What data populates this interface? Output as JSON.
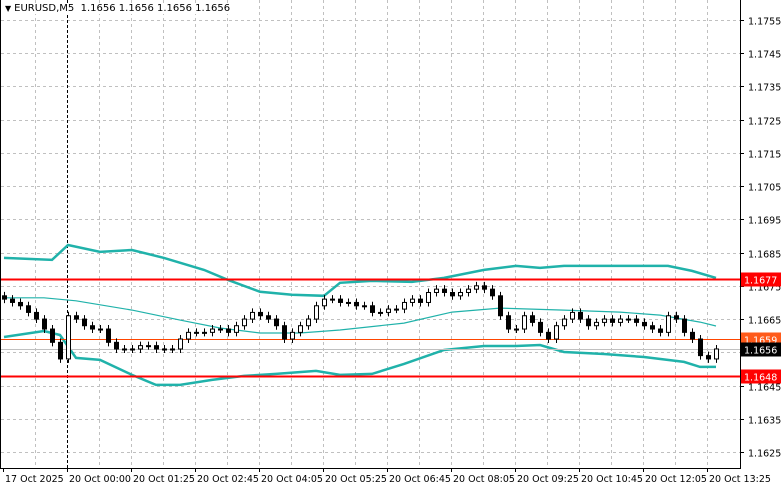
{
  "header": {
    "symbol": "EURUSD,M5",
    "ohlc": "1.1656 1.1656 1.1656 1.1656",
    "menu_icon": "triangle-down-icon"
  },
  "colors": {
    "bull_body": "#ffffff",
    "bear_body": "#000000",
    "bands": "#20b2aa",
    "resistance": "#ff0000",
    "pivot": "#ff4500",
    "bid_line": "#c0c0c0",
    "grid": "#c0c0c0"
  },
  "chart_data": {
    "type": "candlestick",
    "title": "EURUSD,M5",
    "ylim": [
      1.162,
      1.176
    ],
    "y_ticks": [
      "1.1755",
      "1.1745",
      "1.1735",
      "1.1725",
      "1.1715",
      "1.1705",
      "1.1695",
      "1.1685",
      "1.1675",
      "1.1665",
      "1.1655",
      "1.1645",
      "1.1635",
      "1.1625"
    ],
    "x_ticks": [
      {
        "bar": 0,
        "label": "17 Oct 2025"
      },
      {
        "bar": 8,
        "label": "20 Oct 00:00"
      },
      {
        "bar": 16,
        "label": "20 Oct 01:25"
      },
      {
        "bar": 24,
        "label": "20 Oct 02:45"
      },
      {
        "bar": 32,
        "label": "20 Oct 04:05"
      },
      {
        "bar": 40,
        "label": "20 Oct 05:25"
      },
      {
        "bar": 48,
        "label": "20 Oct 06:45"
      },
      {
        "bar": 56,
        "label": "20 Oct 08:05"
      },
      {
        "bar": 64,
        "label": "20 Oct 09:25"
      },
      {
        "bar": 72,
        "label": "20 Oct 10:45"
      },
      {
        "bar": 80,
        "label": "20 Oct 12:05"
      },
      {
        "bar": 88,
        "label": "20 Oct 13:25"
      }
    ],
    "period_separator_bar": 8,
    "closes": [
      1.1671,
      1.167,
      1.1669,
      1.1667,
      1.1665,
      1.1662,
      1.1658,
      1.1653,
      1.1666,
      1.1665,
      1.1663,
      1.1662,
      1.1662,
      1.1658,
      1.1656,
      1.1656,
      1.1656,
      1.1657,
      1.1657,
      1.1656,
      1.1656,
      1.1656,
      1.1659,
      1.1661,
      1.1661,
      1.1661,
      1.1662,
      1.1662,
      1.1661,
      1.1663,
      1.1665,
      1.1667,
      1.1666,
      1.1665,
      1.1663,
      1.1659,
      1.1661,
      1.1663,
      1.1665,
      1.1669,
      1.1671,
      1.1671,
      1.167,
      1.167,
      1.1669,
      1.1669,
      1.1667,
      1.1667,
      1.1668,
      1.1668,
      1.167,
      1.1671,
      1.167,
      1.1673,
      1.1674,
      1.1673,
      1.1672,
      1.1673,
      1.1674,
      1.1675,
      1.1674,
      1.1672,
      1.1666,
      1.1662,
      1.1662,
      1.1666,
      1.1664,
      1.1661,
      1.1659,
      1.1663,
      1.1665,
      1.1667,
      1.1665,
      1.1663,
      1.1664,
      1.1665,
      1.1664,
      1.1665,
      1.1665,
      1.1664,
      1.1663,
      1.1662,
      1.1661,
      1.1666,
      1.1665,
      1.1661,
      1.1659,
      1.1654,
      1.1653,
      1.1656
    ],
    "bollinger": {
      "upper": [
        [
          0,
          1.16834
        ],
        [
          6,
          1.16828
        ],
        [
          8,
          1.16873
        ],
        [
          12,
          1.16852
        ],
        [
          16,
          1.16858
        ],
        [
          20,
          1.16834
        ],
        [
          25,
          1.16798
        ],
        [
          28,
          1.16768
        ],
        [
          32,
          1.16732
        ],
        [
          36,
          1.16723
        ],
        [
          40,
          1.1672
        ],
        [
          42,
          1.16759
        ],
        [
          46,
          1.16765
        ],
        [
          51,
          1.16762
        ],
        [
          55,
          1.16774
        ],
        [
          60,
          1.16798
        ],
        [
          64,
          1.1681
        ],
        [
          67,
          1.16804
        ],
        [
          70,
          1.1681
        ],
        [
          75,
          1.1681
        ],
        [
          83,
          1.1681
        ],
        [
          86,
          1.16795
        ],
        [
          89,
          1.16774
        ]
      ],
      "middle": [
        [
          0,
          1.16714
        ],
        [
          5,
          1.16714
        ],
        [
          9,
          1.16705
        ],
        [
          16,
          1.16677
        ],
        [
          22,
          1.16647
        ],
        [
          27,
          1.16623
        ],
        [
          32,
          1.16608
        ],
        [
          37,
          1.16608
        ],
        [
          42,
          1.16617
        ],
        [
          50,
          1.16638
        ],
        [
          56,
          1.16671
        ],
        [
          62,
          1.16683
        ],
        [
          70,
          1.16677
        ],
        [
          77,
          1.16671
        ],
        [
          82,
          1.16662
        ],
        [
          87,
          1.16641
        ],
        [
          89,
          1.16629
        ]
      ],
      "lower": [
        [
          0,
          1.16596
        ],
        [
          5,
          1.16614
        ],
        [
          7,
          1.16602
        ],
        [
          9,
          1.16533
        ],
        [
          12,
          1.16527
        ],
        [
          16,
          1.16482
        ],
        [
          19,
          1.16452
        ],
        [
          22,
          1.16452
        ],
        [
          26,
          1.16467
        ],
        [
          30,
          1.16479
        ],
        [
          34,
          1.16485
        ],
        [
          39,
          1.16494
        ],
        [
          42,
          1.16482
        ],
        [
          46,
          1.16485
        ],
        [
          50,
          1.16515
        ],
        [
          55,
          1.16557
        ],
        [
          60,
          1.16569
        ],
        [
          64,
          1.16569
        ],
        [
          67,
          1.16572
        ],
        [
          70,
          1.16551
        ],
        [
          75,
          1.16545
        ],
        [
          80,
          1.16536
        ],
        [
          85,
          1.16521
        ],
        [
          87,
          1.16506
        ],
        [
          89,
          1.16506
        ]
      ]
    },
    "levels": [
      {
        "name": "resistance",
        "price": 1.1677,
        "label": "1.1677",
        "color": "#ff0000"
      },
      {
        "name": "pivot",
        "price": 1.1659,
        "label": "1.1659",
        "color": "#ff4500"
      },
      {
        "name": "bid",
        "price": 1.1656,
        "label": "1.1656",
        "color": "#000000"
      },
      {
        "name": "support",
        "price": 1.1648,
        "label": "1.1648",
        "color": "#ff0000"
      }
    ]
  }
}
